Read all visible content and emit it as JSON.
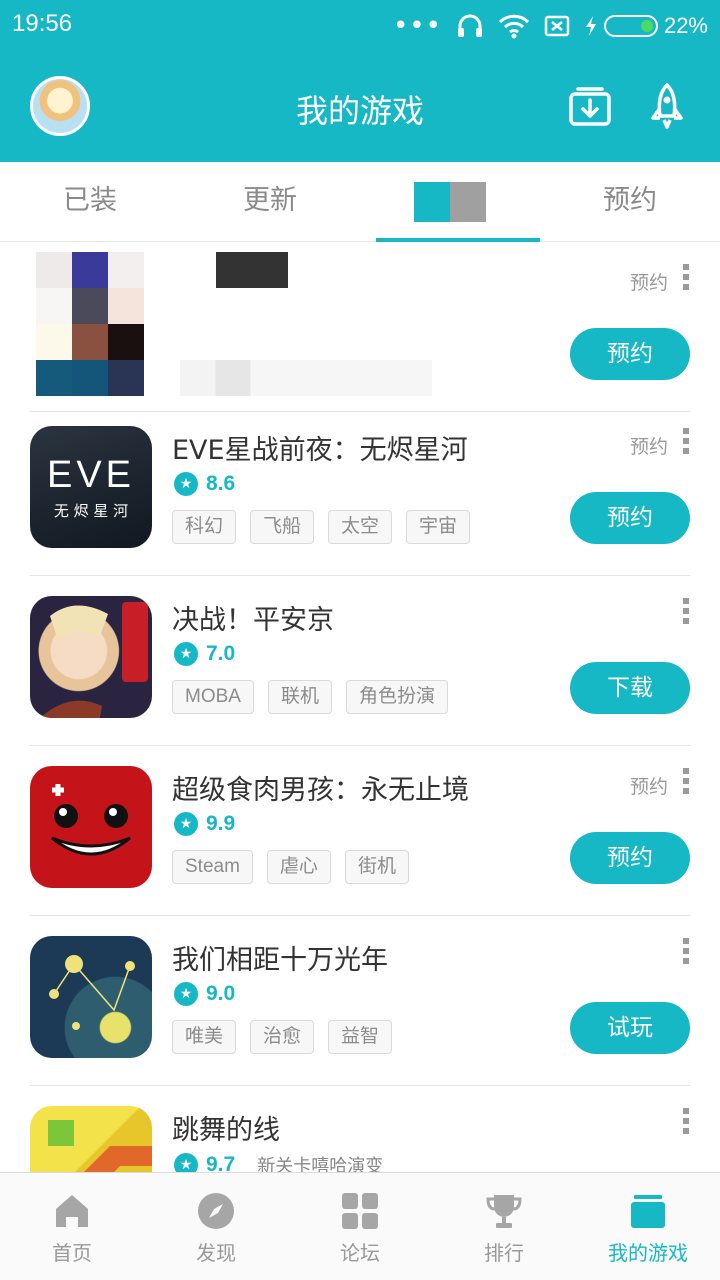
{
  "status": {
    "time": "19:56",
    "battery": "22%"
  },
  "header": {
    "title": "我的游戏",
    "icons": [
      "avatar",
      "download-icon",
      "rocket-icon"
    ]
  },
  "tabs": [
    {
      "label": "已装"
    },
    {
      "label": "更新"
    },
    {
      "label": ""
    },
    {
      "label": "预约"
    }
  ],
  "games": [
    {
      "name": "",
      "score": "",
      "tags": [],
      "state": "预约",
      "button": "预约"
    },
    {
      "name": "EVE星战前夜：无烬星河",
      "score": "8.6",
      "tags": [
        "科幻",
        "飞船",
        "太空",
        "宇宙"
      ],
      "state": "预约",
      "button": "预约",
      "icon_text_top": "EVE",
      "icon_text_bottom": "无 烬 星 河"
    },
    {
      "name": "决战！平安京",
      "score": "7.0",
      "tags": [
        "MOBA",
        "联机",
        "角色扮演"
      ],
      "state": "",
      "button": "下载"
    },
    {
      "name": "超级食肉男孩：永无止境",
      "score": "9.9",
      "tags": [
        "Steam",
        "虐心",
        "街机"
      ],
      "state": "预约",
      "button": "预约"
    },
    {
      "name": "我们相距十万光年",
      "score": "9.0",
      "tags": [
        "唯美",
        "治愈",
        "益智"
      ],
      "state": "",
      "button": "试玩"
    },
    {
      "name": "跳舞的线",
      "score": "9.7",
      "desc": "新关卡嘻哈演变",
      "tags": [],
      "state": "",
      "button": ""
    }
  ],
  "bottom_nav": [
    {
      "label": "首页",
      "icon": "home-icon"
    },
    {
      "label": "发现",
      "icon": "compass-icon"
    },
    {
      "label": "论坛",
      "icon": "grid-icon"
    },
    {
      "label": "排行",
      "icon": "trophy-icon"
    },
    {
      "label": "我的游戏",
      "icon": "box-icon",
      "active": true
    }
  ],
  "colors": {
    "accent": "#17b8c6",
    "text": "#333333",
    "muted": "#8a8a8a"
  }
}
